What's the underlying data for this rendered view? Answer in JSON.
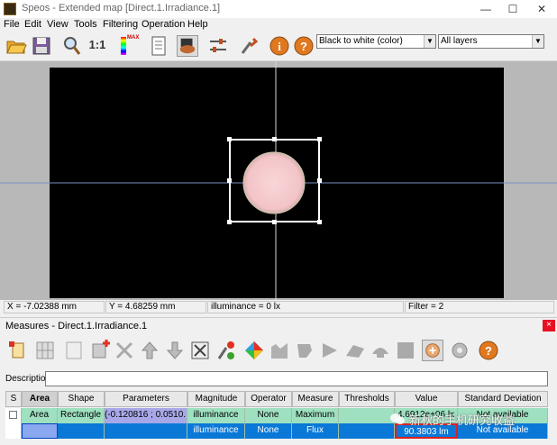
{
  "window": {
    "title": "Speos - Extended map [Direct.1.Irradiance.1]"
  },
  "menu": [
    "File",
    "Edit",
    "View",
    "Tools",
    "Filtering",
    "Operation",
    "Help"
  ],
  "toolbar": {
    "colormap_select": "Black to white (color)",
    "layers_select": "All layers",
    "zoom_label": "1:1",
    "scale_max_label": "MAX"
  },
  "status": {
    "x": "X = -7.02388 mm",
    "y": "Y = 4.68259 mm",
    "value": "illuminance = 0 lx",
    "filter": "Filter = 2"
  },
  "measures": {
    "title": "Measures - Direct.1.Irradiance.1",
    "close": "×",
    "description_label": "Description:",
    "columns": [
      "S",
      "Area",
      "Shape",
      "Parameters",
      "Magnitude",
      "Operator",
      "Measure",
      "Thresholds",
      "Value",
      "Standard Deviation"
    ],
    "rows": [
      {
        "s": "",
        "area": "Area",
        "shape": "Rectangle",
        "parameters": "(-0.120816 ; 0.0510...",
        "magnitude": "illuminance",
        "operator": "None",
        "measure": "Maximum",
        "thresholds": "",
        "value": "4.6912e+06 lx",
        "std": "Not available"
      },
      {
        "s": "",
        "area": "",
        "shape": "",
        "parameters": "",
        "magnitude": "illuminance",
        "operator": "None",
        "measure": "Flux",
        "thresholds": "",
        "value": "90.3803 lm",
        "std": "Not available"
      }
    ]
  },
  "watermark": "新秋的手机研究收益",
  "colors": {
    "accent": "#0a78d7",
    "row_highlight": "#9ee0c0",
    "value_box": "#e02020"
  }
}
